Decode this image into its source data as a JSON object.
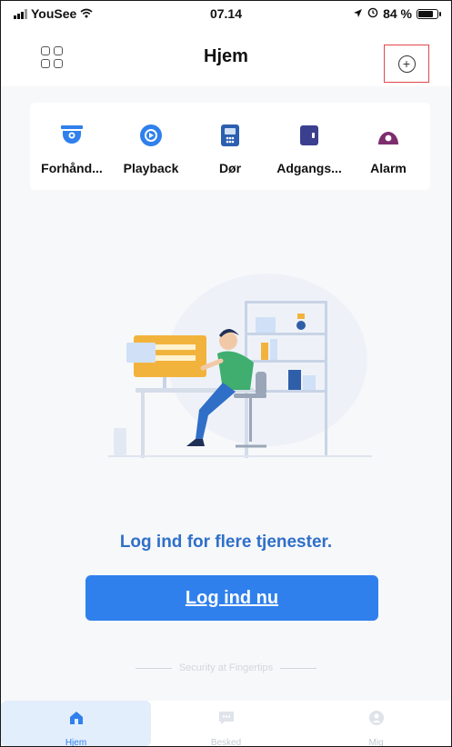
{
  "status_bar": {
    "carrier": "YouSee",
    "time": "07.14",
    "battery_text": "84 %",
    "battery_level": 0.84
  },
  "nav": {
    "title": "Hjem",
    "menu_icon": "grid-icon",
    "add_icon": "plus-circle-icon"
  },
  "quick_access": [
    {
      "label": "Forhånd...",
      "icon": "camera-icon",
      "color": "#2f80ec"
    },
    {
      "label": "Playback",
      "icon": "playback-icon",
      "color": "#2f80ec"
    },
    {
      "label": "Dør",
      "icon": "door-icon",
      "color": "#2b5fb0"
    },
    {
      "label": "Adgangs...",
      "icon": "access-card-icon",
      "color": "#3b3f8f"
    },
    {
      "label": "Alarm",
      "icon": "alarm-icon",
      "color": "#7d2d6e"
    }
  ],
  "main": {
    "login_message": "Log ind for flere tjenester.",
    "login_button": "Log ind nu",
    "slogan": "Security at Fingertips"
  },
  "tabs": [
    {
      "label": "Hjem",
      "icon": "home-icon",
      "active": true
    },
    {
      "label": "Besked",
      "icon": "message-icon",
      "active": false
    },
    {
      "label": "Mig",
      "icon": "profile-icon",
      "active": false
    }
  ],
  "colors": {
    "accent": "#2f80ec",
    "login_text": "#2f6fc8",
    "highlight_box": "#e0474c"
  }
}
